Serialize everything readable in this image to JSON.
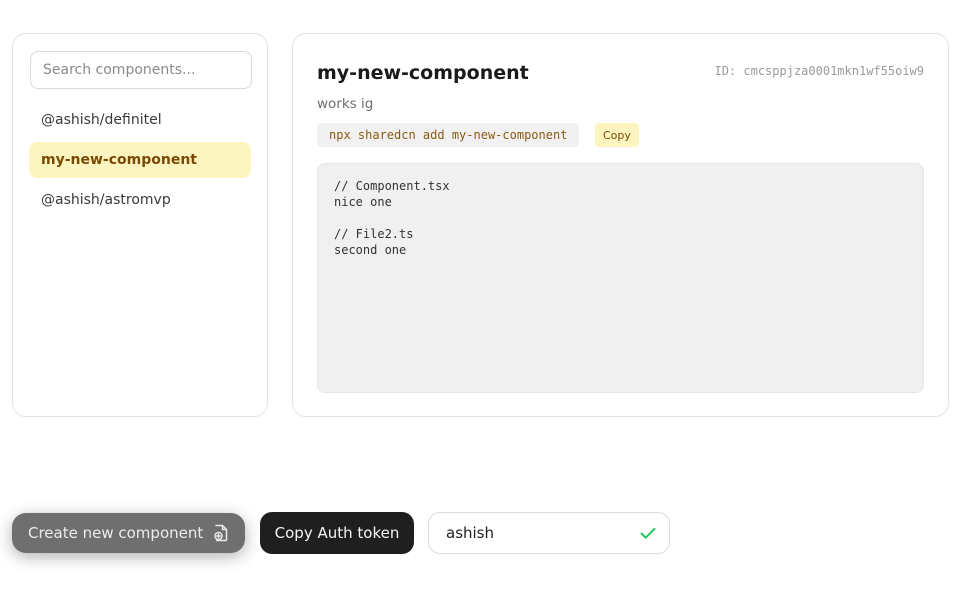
{
  "sidebar": {
    "search": {
      "placeholder": "Search components...",
      "value": ""
    },
    "items": [
      {
        "label": "@ashish/definitel",
        "active": false
      },
      {
        "label": "my-new-component",
        "active": true
      },
      {
        "label": "@ashish/astromvp",
        "active": false
      }
    ]
  },
  "component": {
    "title": "my-new-component",
    "id_text": "ID: cmcsppjza0001mkn1wf55oiw9",
    "description": "works ig",
    "install_command": "npx sharedcn add my-new-component",
    "copy_label": "Copy",
    "code": "// Component.tsx\nnice one\n\n// File2.ts\nsecond one"
  },
  "footer": {
    "create_label": "Create new component",
    "create_icon": "new-file-icon",
    "auth_label": "Copy Auth token",
    "username": {
      "value": "ashish",
      "status_icon": "checkmark-icon"
    }
  },
  "colors": {
    "active_bg": "#fdf5bf",
    "active_text": "#7a4a05",
    "check": "#22c55e",
    "dark_button": "#1f1f1f"
  }
}
